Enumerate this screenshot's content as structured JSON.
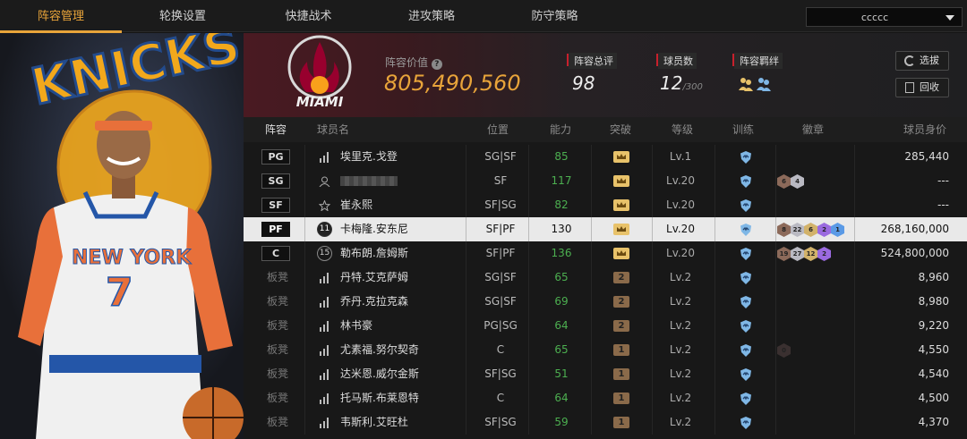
{
  "tabs": [
    "阵容管理",
    "轮换设置",
    "快捷战术",
    "进攻策略",
    "防守策略"
  ],
  "team_select": {
    "value": "ccccc"
  },
  "portrait": {
    "jersey_team": "NEW YORK",
    "jersey_number": "7",
    "bg_logo": "KNICKS"
  },
  "header": {
    "team_logo_text": "MIAMI",
    "lineup_value_label": "阵容价值",
    "lineup_value": "805,490,560",
    "total_rating_label": "阵容总评",
    "total_rating": "98",
    "player_count_label": "球员数",
    "player_count": "12",
    "player_count_max": "/300",
    "bond_label": "阵容羁绊",
    "btn_scout": "选拔",
    "btn_recycle": "回收"
  },
  "columns": [
    "阵容",
    "球员名",
    "位置",
    "能力",
    "突破",
    "等级",
    "训练",
    "徽章",
    "球员身价"
  ],
  "rows": [
    {
      "slot": "PG",
      "name": "埃里克.戈登",
      "pos": "SG|SF",
      "ability": "85",
      "breakthrough": "gold",
      "level": "Lv.1",
      "badges": [],
      "value": "285,440"
    },
    {
      "slot": "SG",
      "name": "",
      "pos": "SF",
      "ability": "117",
      "breakthrough": "gold",
      "level": "Lv.20",
      "badges": [
        "6",
        "4"
      ],
      "value": "---"
    },
    {
      "slot": "SF",
      "name": "崔永熙",
      "pos": "SF|SG",
      "ability": "82",
      "breakthrough": "gold",
      "level": "Lv.20",
      "badges": [],
      "value": "---"
    },
    {
      "slot": "PF",
      "name": "卡梅隆.安东尼",
      "pos": "SF|PF",
      "ability": "130",
      "breakthrough": "gold",
      "level": "Lv.20",
      "badges": [
        "8",
        "22",
        "6",
        "2",
        "1"
      ],
      "value": "268,160,000",
      "highlight": true,
      "number": "11"
    },
    {
      "slot": "C",
      "name": "勒布朗.詹姆斯",
      "pos": "SF|PF",
      "ability": "136",
      "breakthrough": "gold",
      "level": "Lv.20",
      "badges": [
        "19",
        "27",
        "12",
        "2"
      ],
      "value": "524,800,000",
      "number": "15"
    },
    {
      "slot": "板凳",
      "name": "丹特.艾克萨姆",
      "pos": "SG|SF",
      "ability": "65",
      "breakthrough": "2",
      "level": "Lv.2",
      "badges": [],
      "value": "8,960"
    },
    {
      "slot": "板凳",
      "name": "乔丹.克拉克森",
      "pos": "SG|SF",
      "ability": "69",
      "breakthrough": "2",
      "level": "Lv.2",
      "badges": [],
      "value": "8,980"
    },
    {
      "slot": "板凳",
      "name": "林书豪",
      "pos": "PG|SG",
      "ability": "64",
      "breakthrough": "2",
      "level": "Lv.2",
      "badges": [],
      "value": "9,220"
    },
    {
      "slot": "板凳",
      "name": "尤素福.努尔契奇",
      "pos": "C",
      "ability": "65",
      "breakthrough": "1",
      "level": "Lv.2",
      "badges": [
        "0"
      ],
      "value": "4,550"
    },
    {
      "slot": "板凳",
      "name": "达米恩.威尔金斯",
      "pos": "SF|SG",
      "ability": "51",
      "breakthrough": "1",
      "level": "Lv.2",
      "badges": [],
      "value": "4,540"
    },
    {
      "slot": "板凳",
      "name": "托马斯.布莱恩特",
      "pos": "C",
      "ability": "64",
      "breakthrough": "1",
      "level": "Lv.2",
      "badges": [],
      "value": "4,500"
    },
    {
      "slot": "板凳",
      "name": "韦斯利.艾旺杜",
      "pos": "SF|SG",
      "ability": "59",
      "breakthrough": "1",
      "level": "Lv.2",
      "badges": [],
      "value": "4,370"
    }
  ],
  "colors": {
    "accent": "#e8a43a",
    "ability_green": "#4caf50",
    "gold": "#e8c26a",
    "bronze": "#8a6a4a",
    "shield_blue": "#7fb7e6"
  }
}
